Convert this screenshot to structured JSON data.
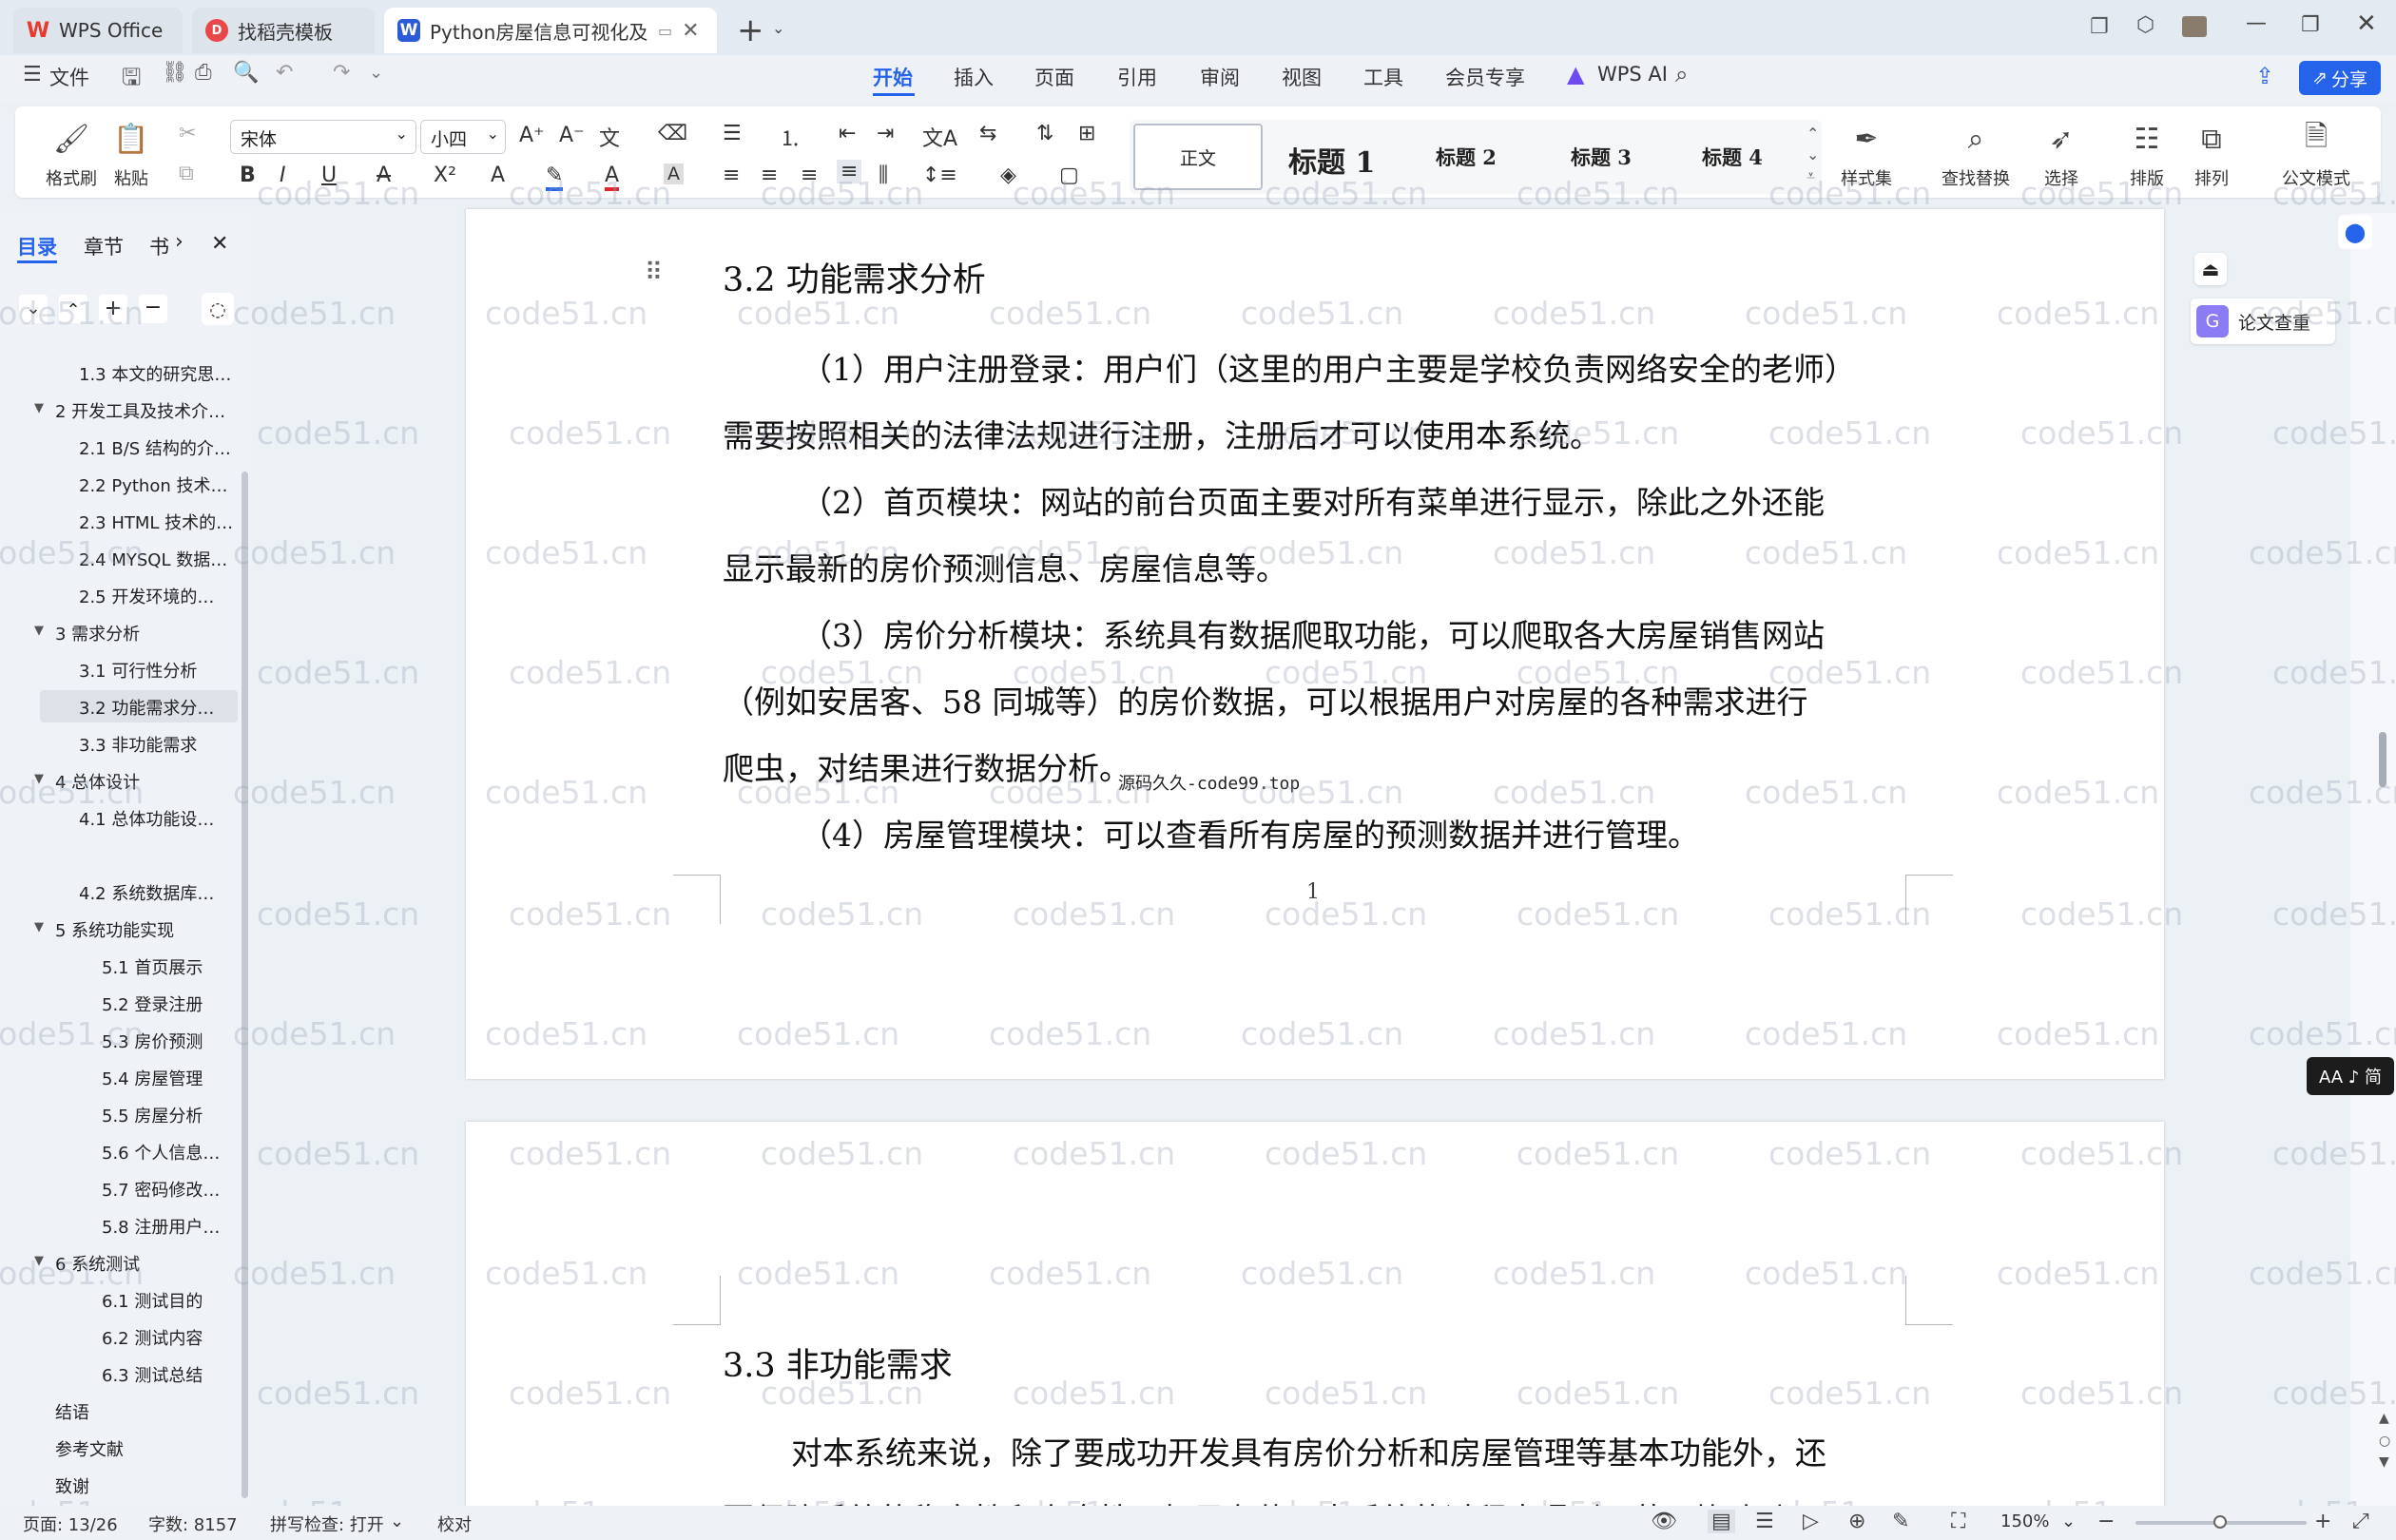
{
  "tabs": [
    {
      "label": "WPS Office",
      "icon": "wps-logo-icon"
    },
    {
      "label": "找稻壳模板",
      "icon": "docer-icon"
    },
    {
      "label": "Python房屋信息可视化及价",
      "icon": "word-doc-icon"
    }
  ],
  "menu": {
    "file": "文件",
    "items": [
      "开始",
      "插入",
      "页面",
      "引用",
      "审阅",
      "视图",
      "工具",
      "会员专享"
    ],
    "wps_ai": "WPS AI",
    "share": "分享"
  },
  "ribbon": {
    "format_painter": "格式刷",
    "paste": "粘贴",
    "font_name": "宋体",
    "font_size": "小四",
    "styles": [
      "正文",
      "标题 1",
      "标题 2",
      "标题 3",
      "标题 4"
    ],
    "style_set": "样式集",
    "find_replace": "查找替换",
    "select": "选择",
    "layout": "排版",
    "arrange": "排列",
    "official_mode": "公文模式"
  },
  "sidebar": {
    "tabs": [
      "目录",
      "章节",
      "书"
    ],
    "items": [
      {
        "label": "1.3 本文的研究思…",
        "level": 2
      },
      {
        "label": "2 开发工具及技术介…",
        "level": 1,
        "expanded": true
      },
      {
        "label": "2.1 B/S 结构的介…",
        "level": 2
      },
      {
        "label": "2.2 Python 技术…",
        "level": 2
      },
      {
        "label": "2.3 HTML 技术的…",
        "level": 2
      },
      {
        "label": "2.4 MYSQL 数据…",
        "level": 2
      },
      {
        "label": "2.5 开发环境的…",
        "level": 2
      },
      {
        "label": "3 需求分析",
        "level": 1,
        "expanded": true
      },
      {
        "label": "3.1 可行性分析",
        "level": 2
      },
      {
        "label": "3.2 功能需求分…",
        "level": 2,
        "active": true
      },
      {
        "label": "3.3 非功能需求",
        "level": 2
      },
      {
        "label": "4 总体设计",
        "level": 1,
        "expanded": true
      },
      {
        "label": "4.1 总体功能设…",
        "level": 2
      },
      {
        "label": "4.2 系统数据库…",
        "level": 2
      },
      {
        "label": "5 系统功能实现",
        "level": 1,
        "expanded": true
      },
      {
        "label": "5.1 首页展示",
        "level": 3
      },
      {
        "label": "5.2 登录注册",
        "level": 3
      },
      {
        "label": "5.3 房价预测",
        "level": 3
      },
      {
        "label": "5.4 房屋管理",
        "level": 3
      },
      {
        "label": "5.5 房屋分析",
        "level": 3
      },
      {
        "label": "5.6 个人信息…",
        "level": 3
      },
      {
        "label": "5.7 密码修改…",
        "level": 3
      },
      {
        "label": "5.8 注册用户…",
        "level": 3
      },
      {
        "label": "6 系统测试",
        "level": 1,
        "expanded": true
      },
      {
        "label": "6.1 测试目的",
        "level": 3
      },
      {
        "label": "6.2 测试内容",
        "level": 3
      },
      {
        "label": "6.3 测试总结",
        "level": 3
      },
      {
        "label": "结语",
        "level": 0
      },
      {
        "label": "参考文献",
        "level": 0
      },
      {
        "label": "致谢",
        "level": 0
      }
    ]
  },
  "document": {
    "heading1": "3.2  功能需求分析",
    "lines": [
      "（1）用户注册登录：用户们（这里的用户主要是学校负责网络安全的老师）",
      "需要按照相关的法律法规进行注册，注册后才可以使用本系统。",
      "（2）首页模块：网站的前台页面主要对所有菜单进行显示，除此之外还能",
      "显示最新的房价预测信息、房屋信息等。",
      "（3）房价分析模块：系统具有数据爬取功能，可以爬取各大房屋销售网站",
      "（例如安居客、58 同城等）的房价数据，可以根据用户对房屋的各种需求进行",
      "爬虫，对结果进行数据分析。",
      "（4）房屋管理模块：可以查看所有房屋的预测数据并进行管理。"
    ],
    "overlay_mark": "源码久久-code99.top",
    "page_number": "1",
    "heading2": "3.3  非功能需求",
    "lines2": [
      "对本系统来说，除了要成功开发具有房价分析和房屋管理等基本功能外，还",
      "要保障系统的稳定性和安全性，如果在使用中系统的过程中遇到，若同饰改动"
    ]
  },
  "right_panel": {
    "paper_check": "论文查重",
    "aa_toggle": "AA ♪ 简"
  },
  "watermark": "code51.cn",
  "statusbar": {
    "page": "页面: 13/26",
    "words": "字数: 8157",
    "spell": "拼写检查: 打开",
    "proof": "校对",
    "zoom": "150%"
  },
  "colors": {
    "accent": "#2563eb",
    "wps_red": "#e63a2e",
    "docer_red": "#e8484a",
    "word_blue": "#2b5bd7",
    "active_toc": "#dde1e8"
  }
}
